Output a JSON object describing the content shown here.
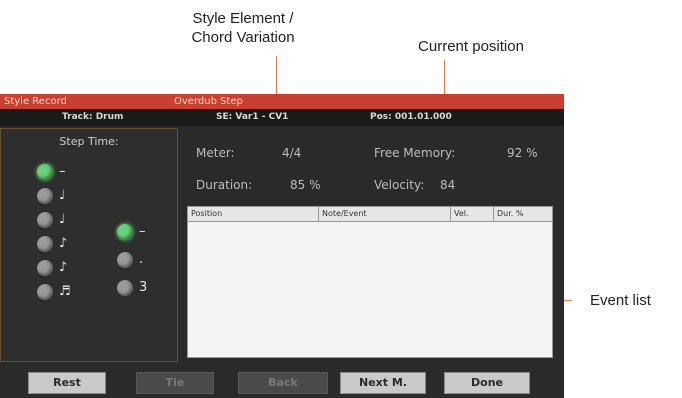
{
  "callouts": {
    "style_element": "Style Element /",
    "chord_variation": "Chord Variation",
    "current_position": "Current position",
    "event_list": "Event list"
  },
  "window": {
    "title": "Style Record",
    "subtitle": "Overdub Step"
  },
  "infobar": {
    "track": "Track: Drum",
    "se": "SE: Var1 - CV1",
    "pos": "Pos: 001.01.000"
  },
  "step_time": {
    "title": "Step Time:",
    "items": [
      {
        "symbol": "–",
        "selected": true
      },
      {
        "symbol": "♩",
        "selected": false
      },
      {
        "symbol": "♩",
        "selected": false
      },
      {
        "symbol": "♪",
        "selected": false
      },
      {
        "symbol": "♪",
        "selected": false
      },
      {
        "symbol": "♬",
        "selected": false
      }
    ],
    "modifiers": [
      {
        "symbol": "–",
        "selected": true
      },
      {
        "symbol": ".",
        "selected": false
      },
      {
        "symbol": "3",
        "selected": false
      }
    ]
  },
  "info": {
    "meter_label": "Meter:",
    "meter_value": "4/4",
    "free_memory_label": "Free Memory:",
    "free_memory_value": "92 %",
    "duration_label": "Duration:",
    "duration_value": "85 %",
    "velocity_label": "Velocity:",
    "velocity_value": "84"
  },
  "event_list": {
    "columns": [
      "Position",
      "Note/Event",
      "Vel.",
      "Dur. %"
    ],
    "rows": []
  },
  "buttons": {
    "rest": "Rest",
    "tie": "Tie",
    "back": "Back",
    "next_m": "Next M.",
    "done": "Done"
  },
  "colors": {
    "title_bar": "#c8402f",
    "callout_line": "#e07a4a",
    "selected_radio": "#6ad07a"
  }
}
